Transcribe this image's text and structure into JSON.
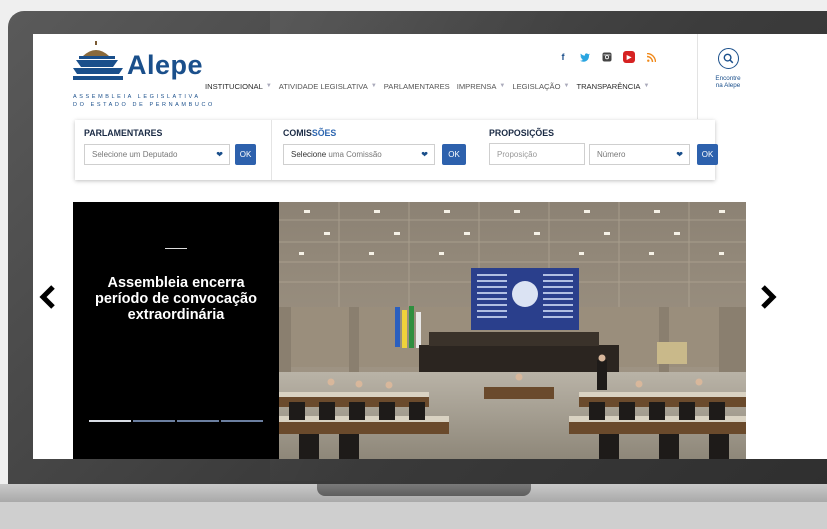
{
  "brand": {
    "name": "Alepe",
    "subtitle_line1": "ASSEMBLEIA LEGISLATIVA",
    "subtitle_line2": "DO ESTADO DE PERNAMBUCO",
    "color": "#1a4f8b"
  },
  "nav": [
    {
      "label": "INSTITUCIONAL",
      "has_dropdown": true
    },
    {
      "label": "ATIVIDADE LEGISLATIVA",
      "has_dropdown": true
    },
    {
      "label": "PARLAMENTARES",
      "has_dropdown": false
    },
    {
      "label": "IMPRENSA",
      "has_dropdown": true
    },
    {
      "label": "LEGISLAÇÃO",
      "has_dropdown": true
    },
    {
      "label": "TRANSPARÊNCIA",
      "has_dropdown": true
    }
  ],
  "social": [
    "facebook-icon",
    "twitter-icon",
    "instagram-icon",
    "youtube-icon",
    "rss-icon"
  ],
  "locate": {
    "line1": "Encontre",
    "line2": "na Alepe"
  },
  "search": {
    "parlamentares": {
      "label": "PARLAMENTARES",
      "select": "Selecione um Deputado",
      "button": "OK"
    },
    "comissoes": {
      "label_main": "COMIS",
      "label_hl": "SÕES",
      "select_dark": "Selecione",
      "select_rest": " uma Comissão",
      "button": "OK"
    },
    "proposicoes": {
      "label": "PROPOSIÇÕES",
      "input_placeholder": "Proposição",
      "select": "Número",
      "button": "OK"
    }
  },
  "slider": {
    "caption": "Assembleia encerra período de convocação extraordinária",
    "slide_count": 4,
    "active_slide": 1
  }
}
